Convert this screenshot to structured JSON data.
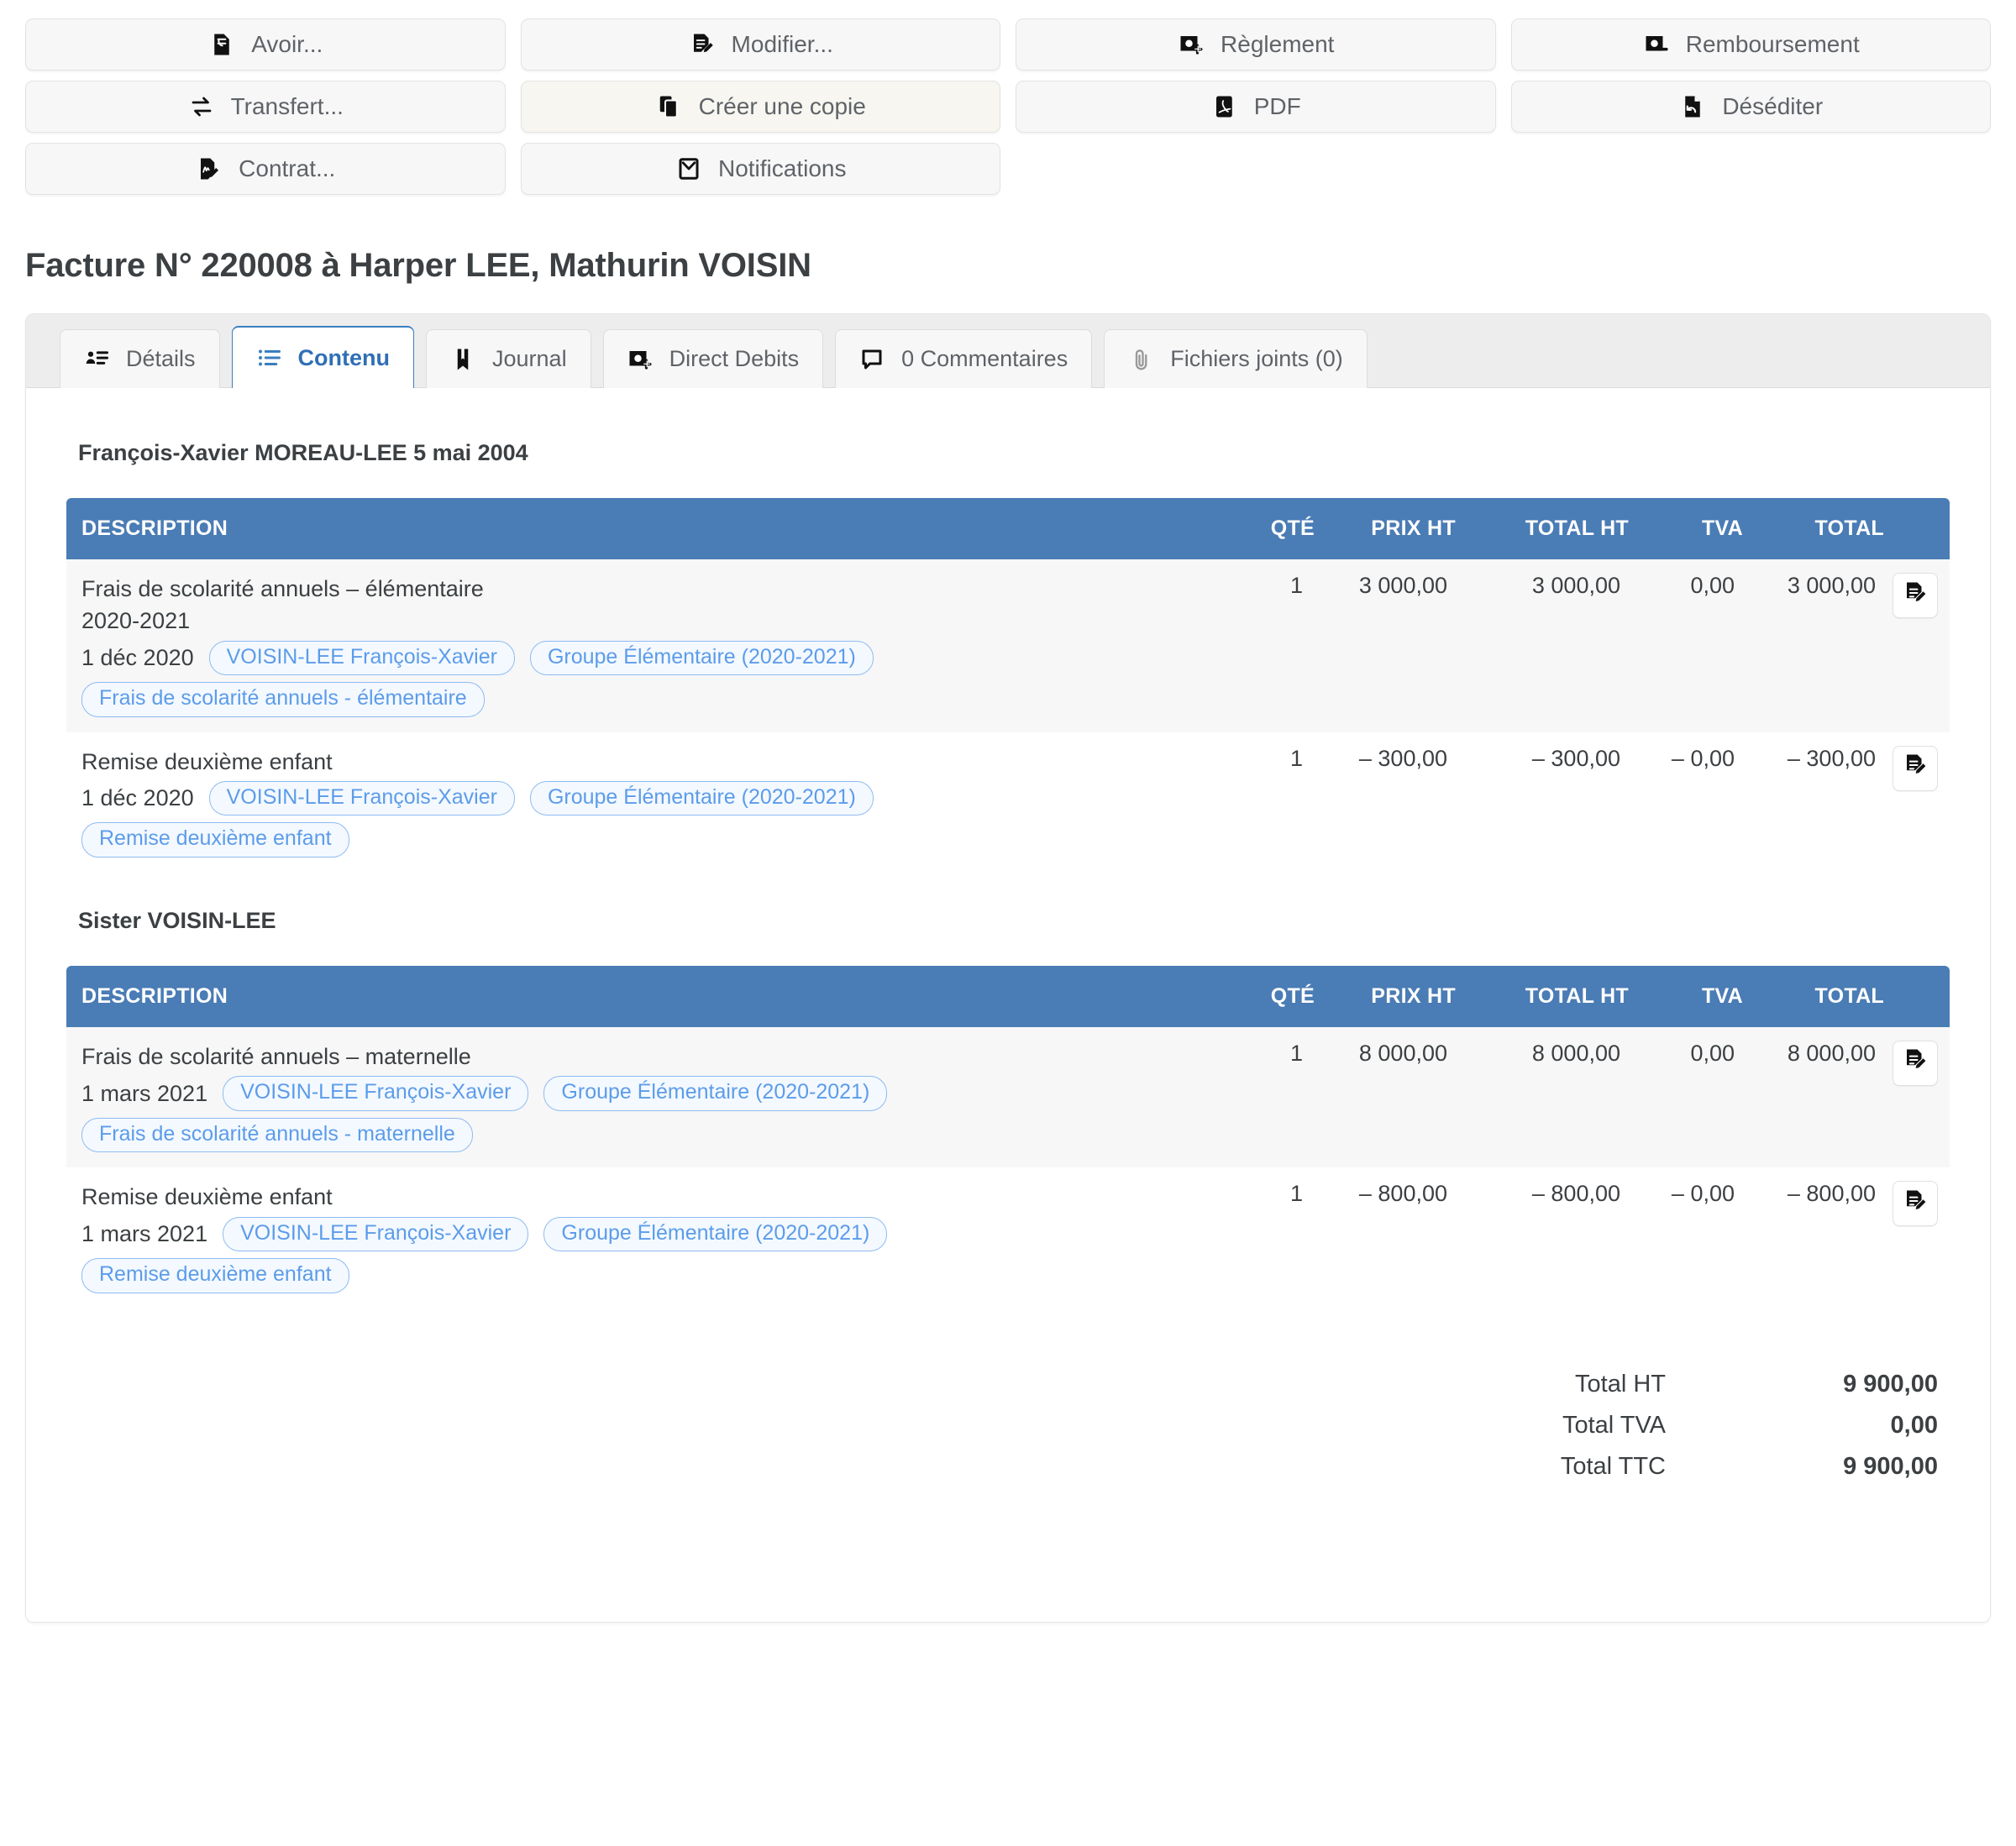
{
  "actions": [
    {
      "label": "Avoir...",
      "icon": "credit-note-icon",
      "highlight": false
    },
    {
      "label": "Modifier...",
      "icon": "edit-document-icon",
      "highlight": false
    },
    {
      "label": "Règlement",
      "icon": "payment-plus-icon",
      "highlight": false
    },
    {
      "label": "Remboursement",
      "icon": "payment-minus-icon",
      "highlight": false
    },
    {
      "label": "Transfert...",
      "icon": "transfer-icon",
      "highlight": false
    },
    {
      "label": "Créer une copie",
      "icon": "copy-icon",
      "highlight": true
    },
    {
      "label": "PDF",
      "icon": "pdf-icon",
      "highlight": false
    },
    {
      "label": "Déséditer",
      "icon": "unpublish-icon",
      "highlight": false
    },
    {
      "label": "Contrat...",
      "icon": "contract-icon",
      "highlight": false
    },
    {
      "label": "Notifications",
      "icon": "envelope-icon",
      "highlight": false
    }
  ],
  "page": {
    "title": "Facture N° 220008 à Harper LEE, Mathurin VOISIN"
  },
  "tabs": [
    {
      "label": "Détails",
      "icon": "contact-details-icon",
      "active": false
    },
    {
      "label": "Contenu",
      "icon": "list-icon",
      "active": true
    },
    {
      "label": "Journal",
      "icon": "book-icon",
      "active": false
    },
    {
      "label": "Direct Debits",
      "icon": "payment-plus-icon",
      "active": false
    },
    {
      "label": "0 Commentaires",
      "icon": "comment-icon",
      "active": false
    },
    {
      "label": "Fichiers joints (0)",
      "icon": "paperclip-icon",
      "active": false
    }
  ],
  "columns": [
    "DESCRIPTION",
    "QTÉ",
    "PRIX HT",
    "TOTAL HT",
    "TVA",
    "TOTAL"
  ],
  "sections": [
    {
      "heading": "François-Xavier MOREAU-LEE 5 mai 2004",
      "rows": [
        {
          "name": "Frais de scolarité annuels – élémentaire",
          "name2": "2020-2021",
          "date": "1 déc 2020",
          "pills": [
            "VOISIN-LEE François-Xavier",
            "Groupe Élémentaire (2020-2021)"
          ],
          "pills2": [
            "Frais de scolarité annuels - élémentaire"
          ],
          "qte": "1",
          "prix_ht": "3 000,00",
          "total_ht": "3 000,00",
          "tva": "0,00",
          "total": "3 000,00"
        },
        {
          "name": "Remise deuxième enfant",
          "name2": "",
          "date": "1 déc 2020",
          "pills": [
            "VOISIN-LEE François-Xavier",
            "Groupe Élémentaire (2020-2021)"
          ],
          "pills2": [
            "Remise deuxième enfant"
          ],
          "qte": "1",
          "prix_ht": "– 300,00",
          "total_ht": "– 300,00",
          "tva": "– 0,00",
          "total": "– 300,00"
        }
      ]
    },
    {
      "heading": "Sister VOISIN-LEE",
      "rows": [
        {
          "name": "Frais de scolarité annuels – maternelle",
          "name2": "",
          "date": "1 mars 2021",
          "pills": [
            "VOISIN-LEE François-Xavier",
            "Groupe Élémentaire (2020-2021)"
          ],
          "pills2": [
            "Frais de scolarité annuels - maternelle"
          ],
          "qte": "1",
          "prix_ht": "8 000,00",
          "total_ht": "8 000,00",
          "tva": "0,00",
          "total": "8 000,00"
        },
        {
          "name": "Remise deuxième enfant",
          "name2": "",
          "date": "1 mars 2021",
          "pills": [
            "VOISIN-LEE François-Xavier",
            "Groupe Élémentaire (2020-2021)"
          ],
          "pills2": [
            "Remise deuxième enfant"
          ],
          "qte": "1",
          "prix_ht": "– 800,00",
          "total_ht": "– 800,00",
          "tva": "– 0,00",
          "total": "– 800,00"
        }
      ]
    }
  ],
  "totals": [
    {
      "label": "Total HT",
      "value": "9 900,00"
    },
    {
      "label": "Total TVA",
      "value": "0,00"
    },
    {
      "label": "Total TTC",
      "value": "9 900,00"
    }
  ],
  "colors": {
    "table_header_blue": "#4a7cb5",
    "active_tab_blue": "#2f6fb5",
    "pill_blue": "#5c9cea",
    "pill_border": "#8ebbf0",
    "pill_bg": "#f4f9ff"
  }
}
